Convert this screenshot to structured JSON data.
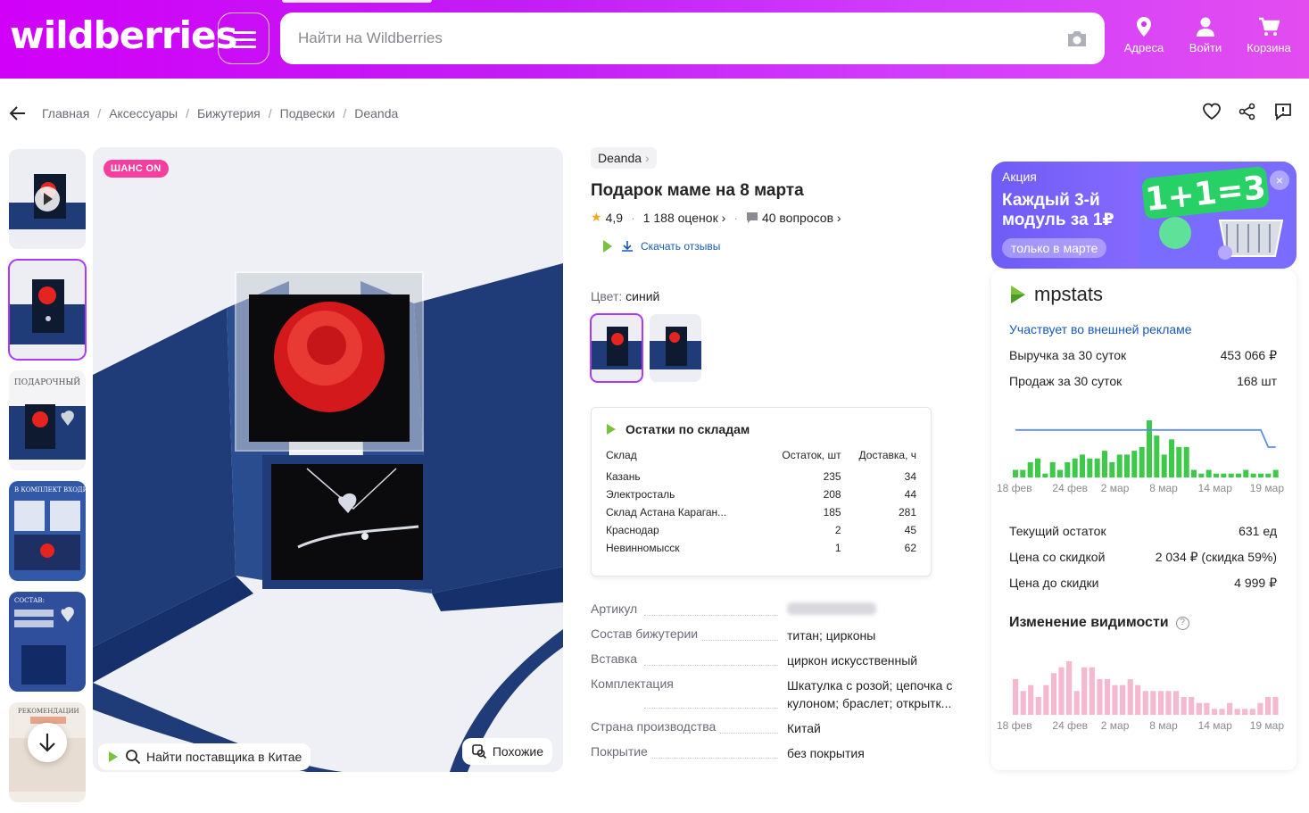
{
  "header": {
    "logo": "wildberries",
    "search_placeholder": "Найти на Wildberries",
    "addresses_label": "Адреса",
    "login_label": "Войти",
    "cart_label": "Корзина"
  },
  "breadcrumbs": [
    "Главная",
    "Аксессуары",
    "Бижутерия",
    "Подвески",
    "Deanda"
  ],
  "gallery": {
    "badge": "ШАНС ON",
    "find_supplier_label": "Найти поставщика в Китае",
    "similar_label": "Похожие"
  },
  "product": {
    "brand": "Deanda",
    "title": "Подарок маме на 8 марта",
    "rating": "4,9",
    "reviews": "1 188 оценок",
    "questions": "40 вопросов",
    "download_reviews": "Скачать отзывы",
    "color_label": "Цвет:",
    "color_value": "синий"
  },
  "stock": {
    "title": "Остатки по складам",
    "headers": [
      "Склад",
      "Остаток, шт",
      "Доставка, ч"
    ],
    "rows": [
      {
        "name": "Казань",
        "qty": "235",
        "delivery": "34"
      },
      {
        "name": "Электросталь",
        "qty": "208",
        "delivery": "44"
      },
      {
        "name": "Склад Астана Караган...",
        "qty": "185",
        "delivery": "281"
      },
      {
        "name": "Краснодар",
        "qty": "2",
        "delivery": "45"
      },
      {
        "name": "Невинномысск",
        "qty": "1",
        "delivery": "62"
      }
    ]
  },
  "specs": [
    {
      "key": "Артикул",
      "value": ""
    },
    {
      "key": "Состав бижутерии",
      "value": "титан; цирконы"
    },
    {
      "key": "Вставка",
      "value": "циркон искусственный"
    },
    {
      "key": "Комплектация",
      "value": "Шкатулка с розой; цепочка с кулоном; браслет; открытк..."
    },
    {
      "key": "Страна производства",
      "value": "Китай"
    },
    {
      "key": "Покрытие",
      "value": "без покрытия"
    }
  ],
  "promo": {
    "label": "Акция",
    "headline": "Каждый 3-й модуль за 1₽",
    "pill": "только в марте",
    "ad_text": "1+1=3"
  },
  "mpstats": {
    "logo": "mpstats",
    "ads_link": "Участвует во внешней рекламе",
    "revenue_label": "Выручка за 30 суток",
    "revenue_value": "453 066 ₽",
    "sales_label": "Продаж за 30 суток",
    "sales_value": "168 шт",
    "stock_label": "Текущий остаток",
    "stock_value": "631 ед",
    "discount_price_label": "Цена со скидкой",
    "discount_price_value": "2 034 ₽ (скидка 59%)",
    "base_price_label": "Цена до скидки",
    "base_price_value": "4 999 ₽",
    "visibility_title": "Изменение видимости",
    "visibility_help": "?"
  },
  "chart_data": [
    {
      "type": "bar",
      "categories": [
        "18 фев",
        "24 фев",
        "2 мар",
        "8 мар",
        "14 мар",
        "19 мар"
      ],
      "values": [
        2,
        2,
        4,
        5,
        1,
        4,
        2,
        4,
        5,
        6,
        5,
        5,
        7,
        4,
        6,
        6,
        7,
        8,
        15,
        11,
        6,
        10,
        8,
        8,
        2,
        1,
        2,
        1,
        1,
        1,
        1,
        2,
        1,
        1,
        1,
        2
      ],
      "line": [
        0.8,
        0.8,
        0.8,
        0.8,
        0.8,
        0.8,
        0.8,
        0.8,
        0.8,
        0.8,
        0.8,
        0.8,
        0.8,
        0.8,
        0.8,
        0.8,
        0.8,
        0.8,
        0.8,
        0.8,
        0.8,
        0.8,
        0.8,
        0.8,
        0.8,
        0.8,
        0.8,
        0.8,
        0.8,
        0.8,
        0.8,
        0.8,
        0.8,
        0.8,
        0.5,
        0.5
      ],
      "color": "#3ec94a",
      "line_color": "#5b8ee6"
    },
    {
      "type": "bar",
      "categories": [
        "18 фев",
        "24 фев",
        "2 мар",
        "8 мар",
        "14 мар",
        "19 мар"
      ],
      "values": [
        6,
        4,
        5,
        3,
        5,
        7,
        8,
        9,
        4,
        8,
        8,
        6,
        6,
        5,
        5,
        6,
        5,
        4,
        4,
        4,
        4,
        4,
        3,
        3,
        2,
        2,
        1,
        1,
        2,
        1,
        1,
        1,
        2,
        3,
        3
      ],
      "color": "#f5b9cf"
    }
  ]
}
